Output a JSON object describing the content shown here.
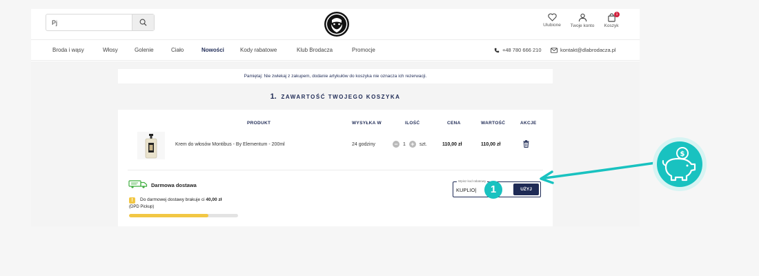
{
  "search": {
    "value": "Pj",
    "placeholder": ""
  },
  "header": {
    "icons": [
      {
        "icon": "heart-icon",
        "label": "Ulubione"
      },
      {
        "icon": "user-icon",
        "label": "Twoje konto"
      },
      {
        "icon": "bag-icon",
        "label": "Koszyk",
        "badge": "1"
      }
    ]
  },
  "nav": {
    "items": [
      {
        "label": "Broda i wąsy"
      },
      {
        "label": "Włosy"
      },
      {
        "label": "Golenie"
      },
      {
        "label": "Ciało"
      },
      {
        "label": "Nowości",
        "active": true
      },
      {
        "label": "Kody rabatowe"
      },
      {
        "label": "Klub Brodacza"
      },
      {
        "label": "Promocje"
      }
    ],
    "phone": "+48 780 666 210",
    "email": "kontakt@dlabrodacza.pl"
  },
  "notice": "Pamiętaj: Nie zwlekaj z zakupem, dodanie artykułów do koszyka nie oznacza ich rezerwacji.",
  "heading": {
    "number": "1.",
    "title": "ZAWARTOŚĆ TWOJEGO KOSZYKA"
  },
  "table": {
    "headers": {
      "product": "PRODUKT",
      "shipping": "WYSYŁKA W",
      "qty": "ILOŚĆ",
      "price": "CENA",
      "value": "WARTOŚĆ",
      "actions": "AKCJE"
    },
    "row": {
      "name": "Krem do włosów Montibus - By Elementum - 200ml",
      "shipping": "24 godziny",
      "qty": "1",
      "unit": "szt.",
      "price": "110,00 zł",
      "value": "110,00 zł"
    }
  },
  "shipping": {
    "title": "Darmowa dostawa",
    "missing_prefix": "Do darmowej dostawy brakuje ci",
    "missing_amount": "40,00 zł",
    "carrier": "(DPD Pickup)",
    "progress_percent": 73
  },
  "coupon": {
    "legend": "Wpisz kod rabatowy",
    "value": "KUPLIO|",
    "button": "UŻYJ"
  },
  "annotation": {
    "step": "1"
  },
  "colors": {
    "navy": "#1e2a55",
    "accent": "#19c2c0",
    "yellow": "#f2c744",
    "badge_red": "#d21f3c"
  }
}
